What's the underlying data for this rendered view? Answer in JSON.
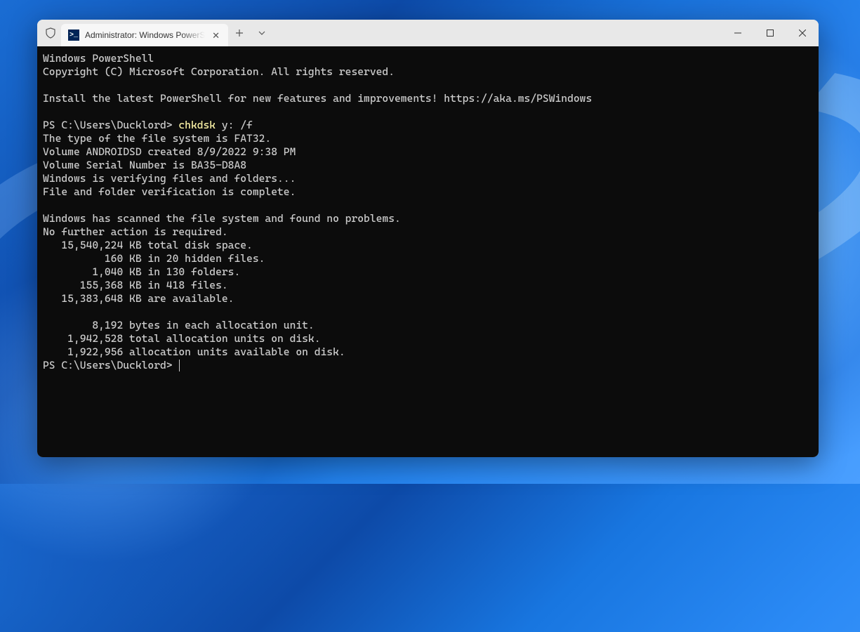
{
  "tab": {
    "title": "Administrator: Windows PowerShell",
    "icon_glyph": ">_"
  },
  "terminal": {
    "header_line1": "Windows PowerShell",
    "header_line2": "Copyright (C) Microsoft Corporation. All rights reserved.",
    "install_msg": "Install the latest PowerShell for new features and improvements! https://aka.ms/PSWindows",
    "prompt1_prefix": "PS C:\\Users\\Ducklord> ",
    "prompt1_cmd": "chkdsk",
    "prompt1_args": " y: /f",
    "out_line1": "The type of the file system is FAT32.",
    "out_line2": "Volume ANDROIDSD created 8/9/2022 9:38 PM",
    "out_line3": "Volume Serial Number is BA35-D8A8",
    "out_line4": "Windows is verifying files and folders...",
    "out_line5": "File and folder verification is complete.",
    "out_line6": "Windows has scanned the file system and found no problems.",
    "out_line7": "No further action is required.",
    "out_line8": "   15,540,224 KB total disk space.",
    "out_line9": "          160 KB in 20 hidden files.",
    "out_line10": "        1,040 KB in 130 folders.",
    "out_line11": "      155,368 KB in 418 files.",
    "out_line12": "   15,383,648 KB are available.",
    "out_line13": "        8,192 bytes in each allocation unit.",
    "out_line14": "    1,942,528 total allocation units on disk.",
    "out_line15": "    1,922,956 allocation units available on disk.",
    "prompt2": "PS C:\\Users\\Ducklord> "
  }
}
